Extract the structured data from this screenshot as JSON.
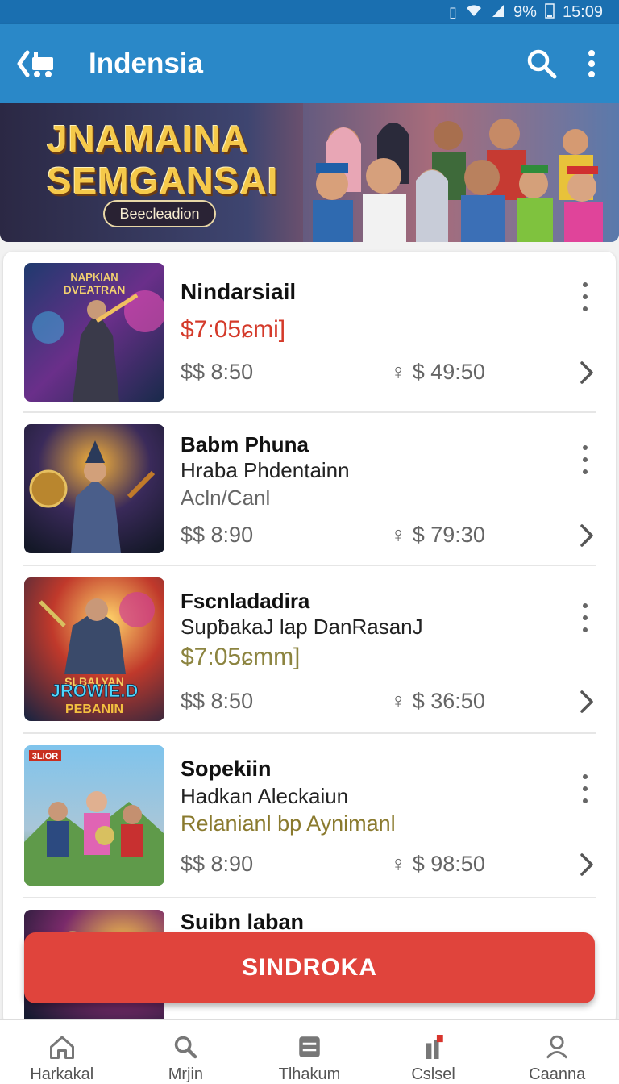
{
  "status": {
    "battery": "9%",
    "time": "15:09"
  },
  "appbar": {
    "title": "Indensia"
  },
  "banner": {
    "line1": "JNAMAINA",
    "line2": "SEMGANSAI",
    "badge": "Beecleadion"
  },
  "items": [
    {
      "name": "Nindarsiail",
      "price": "$7:05ɕmi]",
      "cost": "$$ 8:50",
      "pin": "♀ $ 49:50",
      "thumb_text": "NAPKIAN DVEATRAN"
    },
    {
      "name": "Babm Phuna",
      "sub1": "Hraba Phdentainn",
      "sub2": "Acln/Canl",
      "cost": "$$ 8:90",
      "pin": "♀ $ 79:30"
    },
    {
      "name": "Fscnladadira",
      "sub1": "SupƀakaJ lap DanRasanJ",
      "price": "$7:05ɕmm]",
      "cost": "$$ 8:50",
      "pin": "♀ $ 36:50",
      "thumb_text": "JROWIE.D",
      "thumb_text2": "PEBANIN"
    },
    {
      "name": "Sopekiin",
      "sub1": "Hadkan Aleckaiun",
      "sub2": "Relanianl bp Aynimanl",
      "cost": "$$ 8:90",
      "pin": "♀ $ 98:50",
      "thumb_badge": "3LIOR"
    },
    {
      "name": "Suibn laban"
    }
  ],
  "fab": {
    "label": "SINDROKA"
  },
  "nav": [
    {
      "label": "Harkakal",
      "icon": "home-icon"
    },
    {
      "label": "Mrjin",
      "icon": "search-icon"
    },
    {
      "label": "Tlhakum",
      "icon": "card-icon"
    },
    {
      "label": "Cslsel",
      "icon": "chart-icon"
    },
    {
      "label": "Caanna",
      "icon": "profile-icon"
    }
  ],
  "colors": {
    "appbar": "#2a88c8",
    "statusbar": "#1a6fb0",
    "accent_red": "#e0443c",
    "price_red": "#d43a2a",
    "price_olive": "#8c8440"
  }
}
